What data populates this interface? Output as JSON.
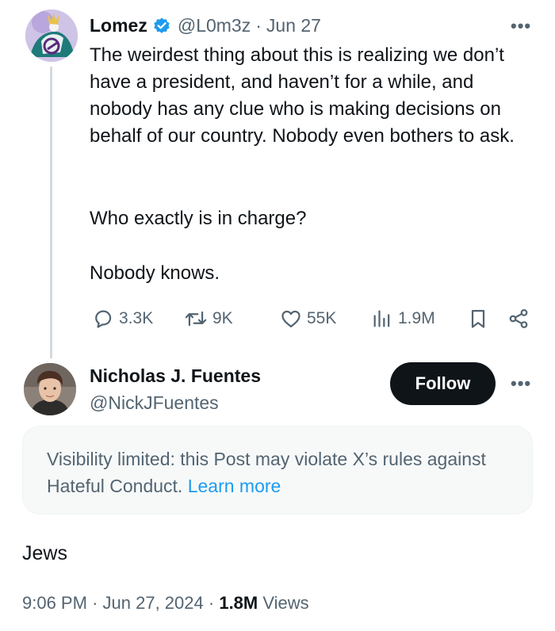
{
  "tweet": {
    "author_name": "Lomez",
    "handle": "@L0m3z",
    "separator": "·",
    "date": "Jun 27",
    "paragraphs": [
      "The weirdest thing about this is realizing we don’t have a president, and haven’t for a while, and nobody has any clue who is making decisions on behalf of our country. Nobody even bothers to ask.",
      "Who exactly is in charge?",
      "Nobody knows."
    ],
    "stats": {
      "replies": "3.3K",
      "reposts": "9K",
      "likes": "55K",
      "views": "1.9M"
    },
    "icons": {
      "verified": "verified-badge-icon",
      "more": "more-dots-icon",
      "reply": "reply-icon",
      "repost": "repost-icon",
      "like": "heart-icon",
      "views": "analytics-icon",
      "bookmark": "bookmark-icon",
      "share": "share-icon"
    }
  },
  "reply": {
    "author_name": "Nicholas J. Fuentes",
    "handle": "@NickJFuentes",
    "follow_label": "Follow",
    "notice_text": "Visibility limited: this Post may violate X’s rules against Hateful Conduct.",
    "notice_link": "Learn more",
    "text": "Jews",
    "time": "9:06 PM",
    "separator": "·",
    "date": "Jun 27, 2024",
    "views_count": "1.8M",
    "views_label": "Views"
  },
  "colors": {
    "text_primary": "#0f1419",
    "text_secondary": "#536471",
    "verified_blue": "#1d9bf0",
    "link_blue": "#1d9bf0",
    "follow_bg": "#0f1419",
    "notice_bg": "#f7f9f9"
  }
}
